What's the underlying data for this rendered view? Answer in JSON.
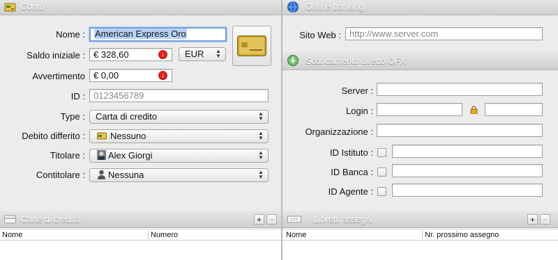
{
  "conto": {
    "header": "Conto",
    "nome_label": "Nome :",
    "nome_value": "American Express Oro",
    "saldo_label": "Saldo iniziale :",
    "saldo_value": "€ 328,60",
    "currency": "EUR",
    "avvertimento_label": "Avvertimento",
    "avvertimento_value": "€ 0,00",
    "id_label": "ID :",
    "id_placeholder": "0123456789",
    "type_label": "Type :",
    "type_value": "Carta di credito",
    "debito_label": "Debito differito :",
    "debito_value": "Nessuno",
    "titolare_label": "Titolare :",
    "titolare_value": "Alex Giorgi",
    "contitolare_label": "Contitolare :",
    "contitolare_value": "Nessuna"
  },
  "online": {
    "header": "Online banking",
    "sito_label": "Sito Web :",
    "sito_placeholder": "http://www.server.com"
  },
  "ofx": {
    "header": "Scaricamento diretto OFX",
    "server_label": "Server :",
    "login_label": "Login :",
    "org_label": "Organizzazione :",
    "istituto_label": "ID Istituto :",
    "banca_label": "ID Banca :",
    "agente_label": "ID Agente :"
  },
  "carte": {
    "header": "Carte di credito",
    "col_nome": "Nome",
    "col_numero": "Numero"
  },
  "libretti": {
    "header": "Libretti assegni",
    "col_nome": "Nome",
    "col_prossimo": "Nr. prossimo assegno"
  },
  "buttons": {
    "add": "+",
    "remove": "−"
  },
  "colors": {
    "accent_focus": "#6d9fe0",
    "warning": "#e02020",
    "header_text": "#ffffff"
  }
}
